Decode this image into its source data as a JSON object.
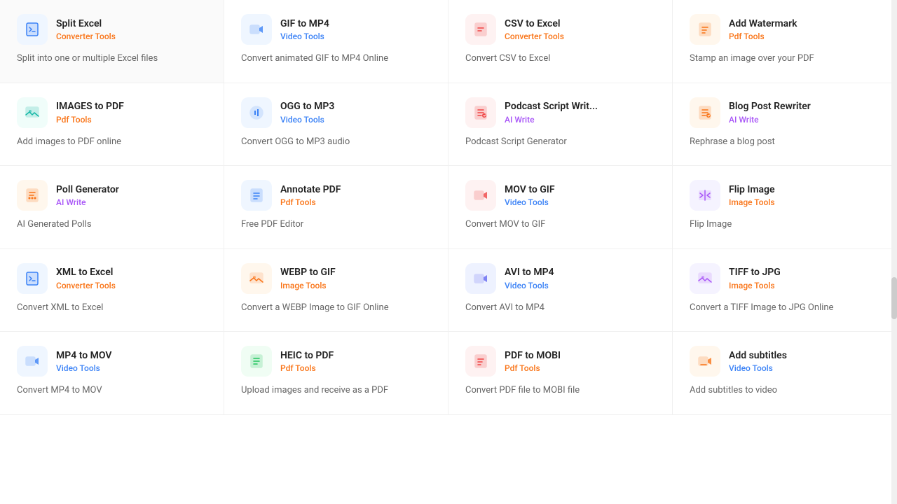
{
  "tools": [
    {
      "id": "split-excel",
      "name": "Split Excel",
      "category": "Converter Tools",
      "category_type": "converter",
      "description": "Split into one or multiple Excel files",
      "icon_color": "bg-blue-light",
      "icon_type": "file-excel"
    },
    {
      "id": "gif-to-mp4",
      "name": "GIF to MP4",
      "category": "Video Tools",
      "category_type": "video",
      "description": "Convert animated GIF to MP4 Online",
      "icon_color": "bg-blue-light",
      "icon_type": "video"
    },
    {
      "id": "csv-to-excel",
      "name": "CSV to Excel",
      "category": "Converter Tools",
      "category_type": "converter",
      "description": "Convert CSV to Excel",
      "icon_color": "bg-red-light",
      "icon_type": "file-csv"
    },
    {
      "id": "add-watermark",
      "name": "Add Watermark",
      "category": "Pdf Tools",
      "category_type": "pdf",
      "description": "Stamp an image over your PDF",
      "icon_color": "bg-orange-light",
      "icon_type": "file-pdf"
    },
    {
      "id": "images-to-pdf",
      "name": "IMAGES to PDF",
      "category": "Pdf Tools",
      "category_type": "pdf",
      "description": "Add images to PDF online",
      "icon_color": "bg-teal-light",
      "icon_type": "image-pdf"
    },
    {
      "id": "ogg-to-mp3",
      "name": "OGG to MP3",
      "category": "Video Tools",
      "category_type": "video",
      "description": "Convert OGG to MP3 audio",
      "icon_color": "bg-blue-light",
      "icon_type": "audio"
    },
    {
      "id": "podcast-script",
      "name": "Podcast Script Writ...",
      "category": "AI Write",
      "category_type": "ai",
      "description": "Podcast Script Generator",
      "icon_color": "bg-red-light",
      "icon_type": "ai-write"
    },
    {
      "id": "blog-post-rewriter",
      "name": "Blog Post Rewriter",
      "category": "AI Write",
      "category_type": "ai",
      "description": "Rephrase a blog post",
      "icon_color": "bg-orange-light",
      "icon_type": "ai-write"
    },
    {
      "id": "poll-generator",
      "name": "Poll Generator",
      "category": "AI Write",
      "category_type": "ai",
      "description": "AI Generated Polls",
      "icon_color": "bg-orange-light",
      "icon_type": "ai-write2"
    },
    {
      "id": "annotate-pdf",
      "name": "Annotate PDF",
      "category": "Pdf Tools",
      "category_type": "pdf",
      "description": "Free PDF Editor",
      "icon_color": "bg-blue-light",
      "icon_type": "file-pdf2"
    },
    {
      "id": "mov-to-gif",
      "name": "MOV to GIF",
      "category": "Video Tools",
      "category_type": "video",
      "description": "Convert MOV to GIF",
      "icon_color": "bg-red-light",
      "icon_type": "video"
    },
    {
      "id": "flip-image",
      "name": "Flip Image",
      "category": "Image Tools",
      "category_type": "image",
      "description": "Flip Image",
      "icon_color": "bg-purple-light",
      "icon_type": "image-flip"
    },
    {
      "id": "xml-to-excel",
      "name": "XML to Excel",
      "category": "Converter Tools",
      "category_type": "converter",
      "description": "Convert XML to Excel",
      "icon_color": "bg-blue-light",
      "icon_type": "file-excel"
    },
    {
      "id": "webp-to-gif",
      "name": "WEBP to GIF",
      "category": "Image Tools",
      "category_type": "image",
      "description": "Convert a WEBP Image to GIF Online",
      "icon_color": "bg-orange-light",
      "icon_type": "image-convert"
    },
    {
      "id": "avi-to-mp4",
      "name": "AVI to MP4",
      "category": "Video Tools",
      "category_type": "video",
      "description": "Convert AVI to MP4",
      "icon_color": "bg-indigo-light",
      "icon_type": "video"
    },
    {
      "id": "tiff-to-jpg",
      "name": "TIFF to JPG",
      "category": "Image Tools",
      "category_type": "image",
      "description": "Convert a TIFF Image to JPG Online",
      "icon_color": "bg-purple-light",
      "icon_type": "image-convert"
    },
    {
      "id": "mp4-to-mov",
      "name": "MP4 to MOV",
      "category": "Video Tools",
      "category_type": "video",
      "description": "Convert MP4 to MOV",
      "icon_color": "bg-blue-light",
      "icon_type": "video"
    },
    {
      "id": "heic-to-pdf",
      "name": "HEIC to PDF",
      "category": "Pdf Tools",
      "category_type": "pdf",
      "description": "Upload images and receive as a PDF",
      "icon_color": "bg-green-light",
      "icon_type": "file-pdf3"
    },
    {
      "id": "pdf-to-mobi",
      "name": "PDF to MOBI",
      "category": "Pdf Tools",
      "category_type": "pdf",
      "description": "Convert PDF file to MOBI file",
      "icon_color": "bg-red-light",
      "icon_type": "file-pdf"
    },
    {
      "id": "add-subtitles",
      "name": "Add subtitles",
      "category": "Video Tools",
      "category_type": "video",
      "description": "Add subtitles to video",
      "icon_color": "bg-orange-light",
      "icon_type": "video2"
    }
  ],
  "colors": {
    "converter": "#f97316",
    "video": "#3b82f6",
    "pdf": "#f97316",
    "ai": "#a855f7",
    "image": "#f97316"
  }
}
